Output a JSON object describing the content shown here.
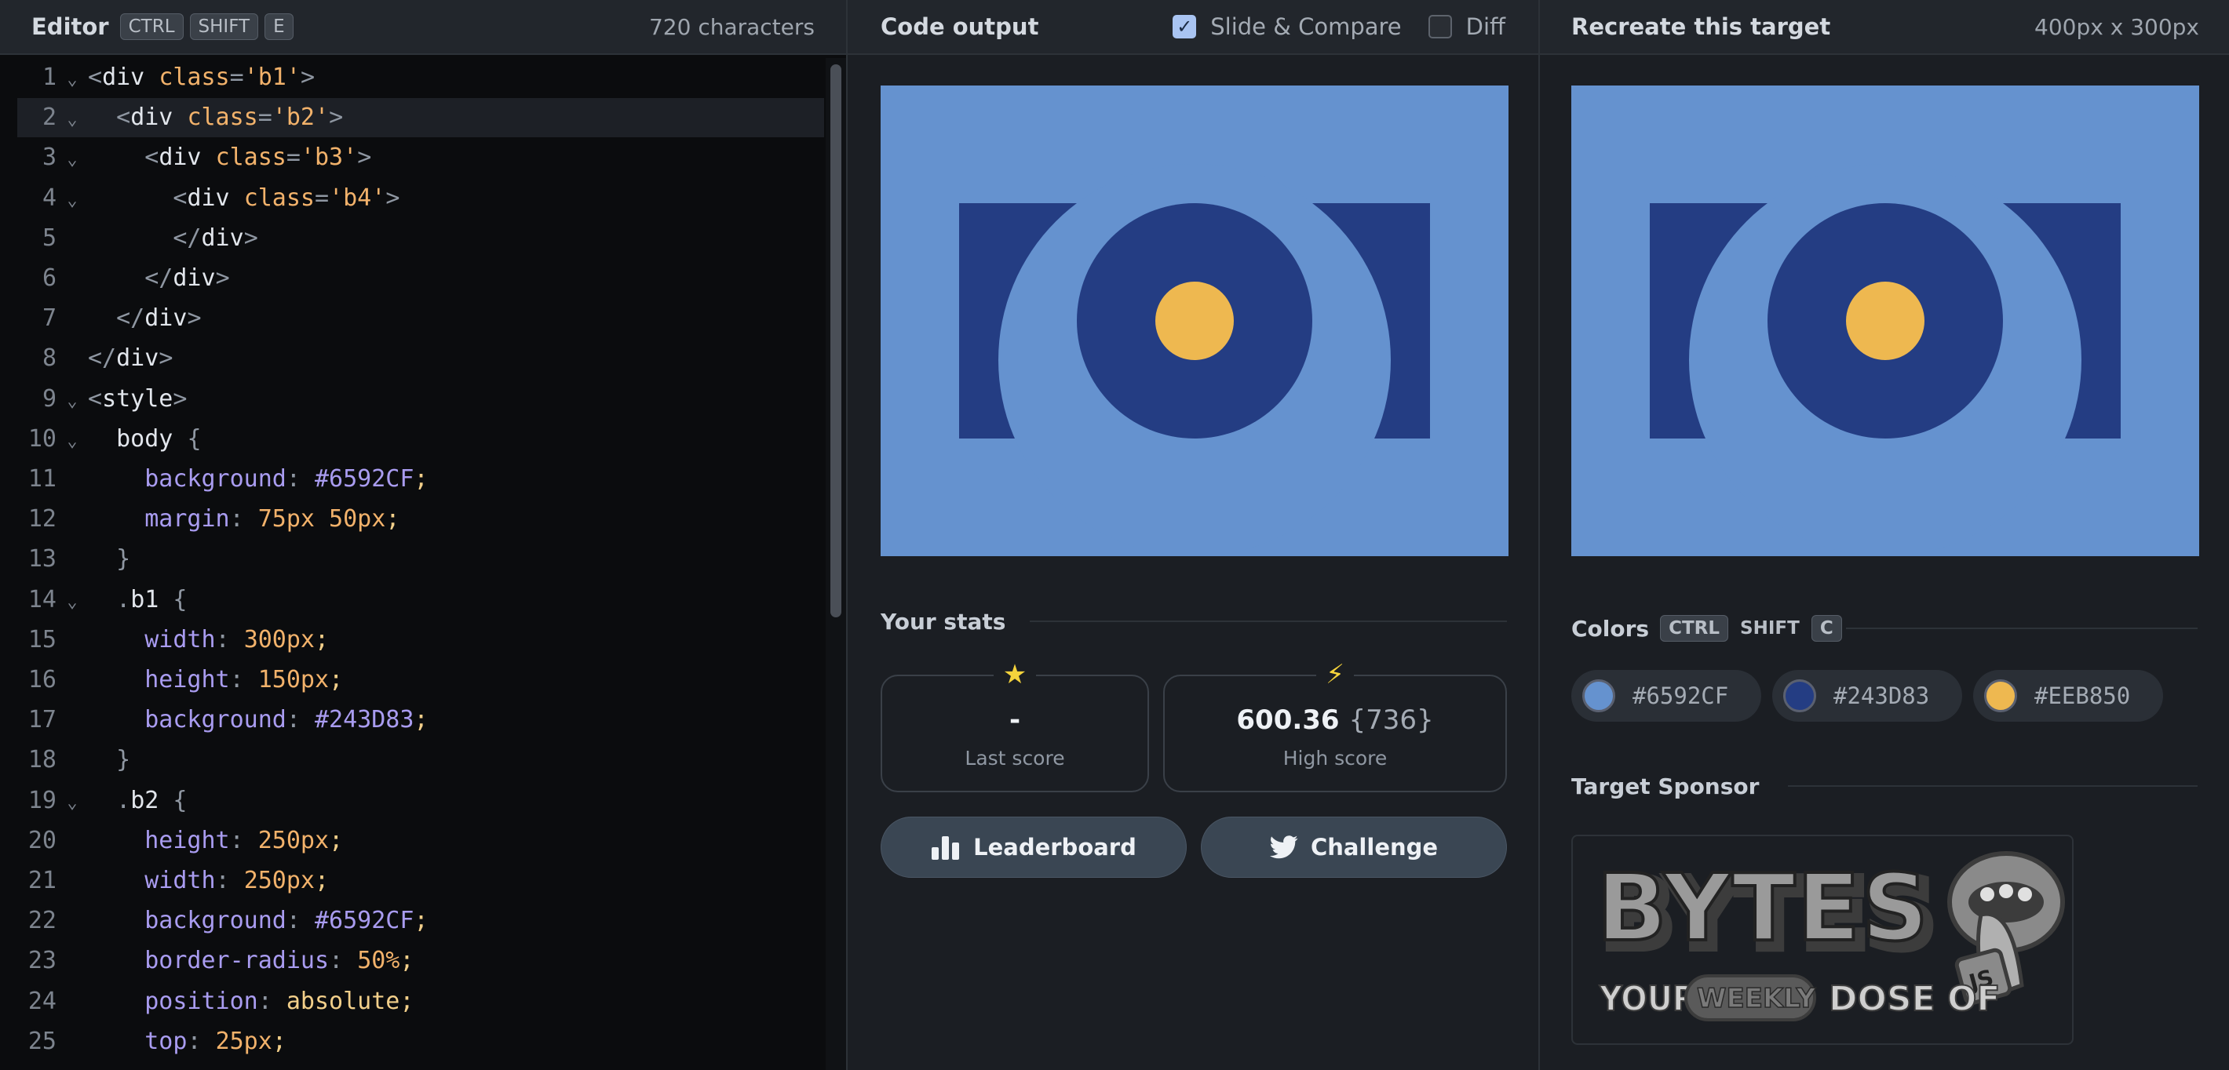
{
  "editor": {
    "title": "Editor",
    "shortcut": [
      "CTRL",
      "SHIFT",
      "E"
    ],
    "char_count": "720 characters",
    "lines": [
      {
        "n": "1",
        "fold": true,
        "tokens": [
          [
            "punc",
            "<"
          ],
          [
            "tag",
            "div "
          ],
          [
            "attr",
            "class"
          ],
          [
            "punc",
            "="
          ],
          [
            "str",
            "'b1'"
          ],
          [
            "punc",
            ">"
          ]
        ]
      },
      {
        "n": "2",
        "fold": true,
        "active": true,
        "tokens": [
          [
            "plain",
            "  "
          ],
          [
            "punc",
            "<"
          ],
          [
            "tag",
            "div "
          ],
          [
            "attr",
            "class"
          ],
          [
            "punc",
            "="
          ],
          [
            "str",
            "'b2'"
          ],
          [
            "punc",
            ">"
          ]
        ]
      },
      {
        "n": "3",
        "fold": true,
        "tokens": [
          [
            "plain",
            "    "
          ],
          [
            "punc",
            "<"
          ],
          [
            "tag",
            "div "
          ],
          [
            "attr",
            "class"
          ],
          [
            "punc",
            "="
          ],
          [
            "str",
            "'b3'"
          ],
          [
            "punc",
            ">"
          ]
        ]
      },
      {
        "n": "4",
        "fold": true,
        "tokens": [
          [
            "plain",
            "      "
          ],
          [
            "punc",
            "<"
          ],
          [
            "tag",
            "div "
          ],
          [
            "attr",
            "class"
          ],
          [
            "punc",
            "="
          ],
          [
            "str",
            "'b4'"
          ],
          [
            "punc",
            ">"
          ]
        ]
      },
      {
        "n": "5",
        "fold": false,
        "tokens": [
          [
            "plain",
            "      "
          ],
          [
            "punc",
            "</"
          ],
          [
            "tag",
            "div"
          ],
          [
            "punc",
            ">"
          ]
        ]
      },
      {
        "n": "6",
        "fold": false,
        "tokens": [
          [
            "plain",
            "    "
          ],
          [
            "punc",
            "</"
          ],
          [
            "tag",
            "div"
          ],
          [
            "punc",
            ">"
          ]
        ]
      },
      {
        "n": "7",
        "fold": false,
        "tokens": [
          [
            "plain",
            "  "
          ],
          [
            "punc",
            "</"
          ],
          [
            "tag",
            "div"
          ],
          [
            "punc",
            ">"
          ]
        ]
      },
      {
        "n": "8",
        "fold": false,
        "tokens": [
          [
            "punc",
            "</"
          ],
          [
            "tag",
            "div"
          ],
          [
            "punc",
            ">"
          ]
        ]
      },
      {
        "n": "9",
        "fold": true,
        "tokens": [
          [
            "punc",
            "<"
          ],
          [
            "tag",
            "style"
          ],
          [
            "punc",
            ">"
          ]
        ]
      },
      {
        "n": "10",
        "fold": true,
        "tokens": [
          [
            "plain",
            "  "
          ],
          [
            "sel",
            "body "
          ],
          [
            "punc",
            "{"
          ]
        ]
      },
      {
        "n": "11",
        "fold": false,
        "tokens": [
          [
            "plain",
            "    "
          ],
          [
            "prop",
            "background"
          ],
          [
            "punc",
            ": "
          ],
          [
            "hex",
            "#6592CF"
          ],
          [
            "kw",
            ";"
          ]
        ]
      },
      {
        "n": "12",
        "fold": false,
        "tokens": [
          [
            "plain",
            "    "
          ],
          [
            "prop",
            "margin"
          ],
          [
            "punc",
            ": "
          ],
          [
            "num",
            "75px 50px"
          ],
          [
            "kw",
            ";"
          ]
        ]
      },
      {
        "n": "13",
        "fold": false,
        "tokens": [
          [
            "plain",
            "  "
          ],
          [
            "punc",
            "}"
          ]
        ]
      },
      {
        "n": "14",
        "fold": true,
        "tokens": [
          [
            "plain",
            "  "
          ],
          [
            "punc",
            "."
          ],
          [
            "sel",
            "b1 "
          ],
          [
            "punc",
            "{"
          ]
        ]
      },
      {
        "n": "15",
        "fold": false,
        "tokens": [
          [
            "plain",
            "    "
          ],
          [
            "prop",
            "width"
          ],
          [
            "punc",
            ": "
          ],
          [
            "num",
            "300px"
          ],
          [
            "kw",
            ";"
          ]
        ]
      },
      {
        "n": "16",
        "fold": false,
        "tokens": [
          [
            "plain",
            "    "
          ],
          [
            "prop",
            "height"
          ],
          [
            "punc",
            ": "
          ],
          [
            "num",
            "150px"
          ],
          [
            "kw",
            ";"
          ]
        ]
      },
      {
        "n": "17",
        "fold": false,
        "tokens": [
          [
            "plain",
            "    "
          ],
          [
            "prop",
            "background"
          ],
          [
            "punc",
            ": "
          ],
          [
            "hex",
            "#243D83"
          ],
          [
            "kw",
            ";"
          ]
        ]
      },
      {
        "n": "18",
        "fold": false,
        "tokens": [
          [
            "plain",
            "  "
          ],
          [
            "punc",
            "}"
          ]
        ]
      },
      {
        "n": "19",
        "fold": true,
        "tokens": [
          [
            "plain",
            "  "
          ],
          [
            "punc",
            "."
          ],
          [
            "sel",
            "b2 "
          ],
          [
            "punc",
            "{"
          ]
        ]
      },
      {
        "n": "20",
        "fold": false,
        "tokens": [
          [
            "plain",
            "    "
          ],
          [
            "prop",
            "height"
          ],
          [
            "punc",
            ": "
          ],
          [
            "num",
            "250px"
          ],
          [
            "kw",
            ";"
          ]
        ]
      },
      {
        "n": "21",
        "fold": false,
        "tokens": [
          [
            "plain",
            "    "
          ],
          [
            "prop",
            "width"
          ],
          [
            "punc",
            ": "
          ],
          [
            "num",
            "250px"
          ],
          [
            "kw",
            ";"
          ]
        ]
      },
      {
        "n": "22",
        "fold": false,
        "tokens": [
          [
            "plain",
            "    "
          ],
          [
            "prop",
            "background"
          ],
          [
            "punc",
            ": "
          ],
          [
            "hex",
            "#6592CF"
          ],
          [
            "kw",
            ";"
          ]
        ]
      },
      {
        "n": "23",
        "fold": false,
        "tokens": [
          [
            "plain",
            "    "
          ],
          [
            "prop",
            "border-radius"
          ],
          [
            "punc",
            ": "
          ],
          [
            "num",
            "50%"
          ],
          [
            "kw",
            ";"
          ]
        ]
      },
      {
        "n": "24",
        "fold": false,
        "tokens": [
          [
            "plain",
            "    "
          ],
          [
            "prop",
            "position"
          ],
          [
            "punc",
            ": "
          ],
          [
            "kw",
            "absolute;"
          ]
        ]
      },
      {
        "n": "25",
        "fold": false,
        "tokens": [
          [
            "plain",
            "    "
          ],
          [
            "prop",
            "top"
          ],
          [
            "punc",
            ": "
          ],
          [
            "num",
            "25px"
          ],
          [
            "kw",
            ";"
          ]
        ]
      }
    ]
  },
  "output": {
    "title": "Code output",
    "slide_compare_label": "Slide & Compare",
    "slide_compare_checked": true,
    "diff_label": "Diff",
    "diff_checked": false
  },
  "target": {
    "title": "Recreate this target",
    "size": "400px x 300px"
  },
  "stats": {
    "title": "Your stats",
    "last_score_value": "-",
    "last_score_label": "Last score",
    "high_score_value": "600.36",
    "high_score_chars": "{736}",
    "high_score_label": "High score",
    "last_score_icon": "star-icon",
    "high_score_icon": "lightning-icon",
    "leaderboard_label": "Leaderboard",
    "challenge_label": "Challenge"
  },
  "colors": {
    "title": "Colors",
    "shortcut": [
      "CTRL",
      "SHIFT",
      "C"
    ],
    "swatches": [
      {
        "hex": "#6592CF",
        "label": "#6592CF"
      },
      {
        "hex": "#243D83",
        "label": "#243D83"
      },
      {
        "hex": "#EEB850",
        "label": "#EEB850"
      }
    ]
  },
  "sponsor": {
    "title": "Target Sponsor",
    "logo_word": "BYTES",
    "tagline_left": "YOUR",
    "tagline_badge": "WEEKLY",
    "tagline_right": "DOSE OF",
    "badge_js": "JS"
  },
  "palette": {
    "light_blue": "#6592CF",
    "dark_blue": "#243D83",
    "yellow": "#EEB850"
  }
}
